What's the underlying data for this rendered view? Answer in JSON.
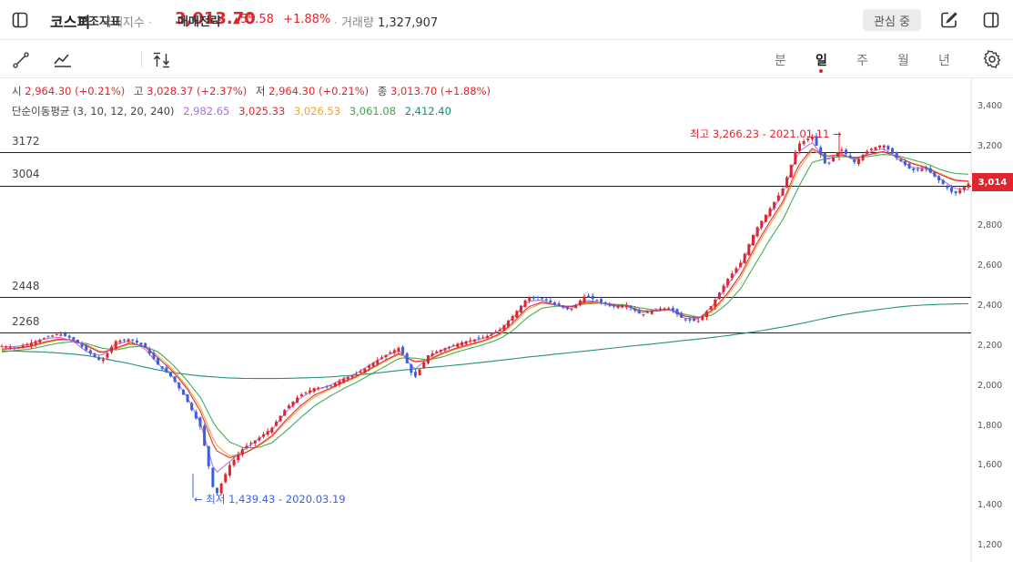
{
  "header": {
    "title": "코스피",
    "category": "국내지수",
    "price": "3,013.70",
    "change_arrow": "▲",
    "change": "55.58",
    "change_pct": "+1.88%",
    "volume_label": "거래량",
    "volume": "1,327,907",
    "favorite_label": "관심 중"
  },
  "toolbar": {
    "indicator_label": "보조지표",
    "strategy_label": "매매전략",
    "periods": [
      "분",
      "일",
      "주",
      "월",
      "년"
    ],
    "active_period": "일"
  },
  "ohlc": {
    "open_label": "시",
    "open": "2,964.30 (+0.21%)",
    "high_label": "고",
    "high": "3,028.37 (+2.37%)",
    "low_label": "저",
    "low": "2,964.30 (+0.21%)",
    "close_label": "종",
    "close": "3,013.70 (+1.88%)"
  },
  "ma": {
    "label": "단순이동평균 (3, 10, 12, 20, 240)",
    "values": [
      "2,982.65",
      "3,025.33",
      "3,026.53",
      "3,061.08",
      "2,412.40"
    ],
    "colors": [
      "#b06fd8",
      "#e0262c",
      "#f0a030",
      "#3aa84a",
      "#1a8a78"
    ]
  },
  "levels": [
    "3172",
    "3004",
    "2448",
    "2268"
  ],
  "current_price_tag": "3,014",
  "annotations": {
    "high": "최고 3,266.23 - 2021.01.11",
    "low": "최저 1,439.43 - 2020.03.19"
  },
  "colors": {
    "up": "#e0262c",
    "down": "#3c5fe0",
    "accent": "#e0262c"
  },
  "chart_data": {
    "type": "candlestick",
    "y_ticks": [
      "3,400",
      "3,200",
      "3,000",
      "2,800",
      "2,600",
      "2,400",
      "2,200",
      "2,000",
      "1,800",
      "1,600",
      "1,400",
      "1,200"
    ],
    "ylim": [
      1200,
      3400
    ],
    "horizontal_levels": [
      3172,
      3004,
      2448,
      2268
    ],
    "high": {
      "value": 3266.23,
      "date": "2021.01.11"
    },
    "low": {
      "value": 1439.43,
      "date": "2020.03.19"
    },
    "last_close": 3013.7,
    "close_path": [
      2200,
      2190,
      2215,
      2240,
      2262,
      2235,
      2175,
      2120,
      2225,
      2235,
      2200,
      2105,
      2040,
      1930,
      1790,
      1440,
      1600,
      1690,
      1735,
      1790,
      1890,
      1955,
      1990,
      1995,
      2035,
      2060,
      2110,
      2155,
      2195,
      2035,
      2155,
      2185,
      2210,
      2230,
      2245,
      2280,
      2355,
      2445,
      2440,
      2405,
      2380,
      2450,
      2425,
      2398,
      2405,
      2355,
      2388,
      2390,
      2330,
      2325,
      2410,
      2530,
      2620,
      2780,
      2885,
      2995,
      3210,
      3250,
      3100,
      3190,
      3120,
      3185,
      3210,
      3140,
      3080,
      3090,
      3025,
      2960,
      3013.7
    ],
    "ma_series": [
      {
        "name": "3",
        "last": 2982.65,
        "values": [
          2195,
          2198,
          2210,
          2235,
          2245,
          2225,
          2170,
          2150,
          2210,
          2225,
          2190,
          2110,
          2050,
          1950,
          1810,
          1560,
          1620,
          1680,
          1730,
          1780,
          1870,
          1940,
          1980,
          2000,
          2035,
          2065,
          2110,
          2150,
          2180,
          2080,
          2140,
          2180,
          2205,
          2225,
          2240,
          2275,
          2345,
          2425,
          2430,
          2405,
          2385,
          2430,
          2420,
          2400,
          2400,
          2365,
          2380,
          2385,
          2340,
          2335,
          2400,
          2500,
          2600,
          2750,
          2860,
          2970,
          3170,
          3220,
          3130,
          3170,
          3130,
          3170,
          3190,
          3140,
          3095,
          3090,
          3040,
          2990,
          2982.65
        ]
      },
      {
        "name": "10",
        "last": 3025.33,
        "values": [
          2185,
          2190,
          2200,
          2220,
          2235,
          2230,
          2200,
          2165,
          2190,
          2215,
          2200,
          2140,
          2075,
          1990,
          1870,
          1680,
          1640,
          1660,
          1700,
          1750,
          1830,
          1900,
          1955,
          1985,
          2020,
          2050,
          2090,
          2130,
          2165,
          2120,
          2130,
          2165,
          2190,
          2210,
          2230,
          2260,
          2320,
          2395,
          2420,
          2405,
          2395,
          2420,
          2420,
          2405,
          2400,
          2375,
          2375,
          2385,
          2350,
          2340,
          2380,
          2460,
          2560,
          2700,
          2820,
          2930,
          3100,
          3190,
          3150,
          3160,
          3140,
          3160,
          3175,
          3150,
          3115,
          3095,
          3060,
          3030,
          3025.33
        ]
      },
      {
        "name": "12",
        "last": 3026.53,
        "values": [
          2180,
          2188,
          2195,
          2215,
          2230,
          2230,
          2205,
          2170,
          2185,
          2210,
          2200,
          2150,
          2085,
          2000,
          1890,
          1710,
          1650,
          1660,
          1695,
          1745,
          1820,
          1890,
          1945,
          1980,
          2015,
          2045,
          2085,
          2125,
          2160,
          2125,
          2125,
          2160,
          2185,
          2205,
          2225,
          2255,
          2310,
          2385,
          2415,
          2405,
          2395,
          2415,
          2418,
          2405,
          2400,
          2378,
          2375,
          2383,
          2352,
          2340,
          2370,
          2450,
          2545,
          2685,
          2805,
          2915,
          3080,
          3180,
          3150,
          3158,
          3140,
          3158,
          3172,
          3150,
          3118,
          3098,
          3065,
          3035,
          3026.53
        ]
      },
      {
        "name": "20",
        "last": 3061.08,
        "values": [
          2170,
          2178,
          2185,
          2200,
          2215,
          2222,
          2212,
          2190,
          2180,
          2195,
          2200,
          2170,
          2110,
          2030,
          1940,
          1800,
          1720,
          1690,
          1690,
          1715,
          1775,
          1840,
          1900,
          1945,
          1985,
          2020,
          2060,
          2100,
          2140,
          2140,
          2130,
          2145,
          2170,
          2190,
          2210,
          2235,
          2280,
          2345,
          2390,
          2400,
          2400,
          2410,
          2415,
          2410,
          2405,
          2390,
          2380,
          2380,
          2360,
          2345,
          2355,
          2410,
          2490,
          2610,
          2730,
          2840,
          2990,
          3120,
          3140,
          3150,
          3145,
          3150,
          3160,
          3155,
          3135,
          3115,
          3085,
          3065,
          3061.08
        ]
      },
      {
        "name": "240",
        "last": 2412.4,
        "values": [
          2175,
          2175,
          2172,
          2170,
          2165,
          2160,
          2152,
          2140,
          2125,
          2112,
          2095,
          2080,
          2068,
          2058,
          2050,
          2045,
          2040,
          2038,
          2037,
          2037,
          2038,
          2040,
          2042,
          2045,
          2050,
          2055,
          2062,
          2070,
          2078,
          2085,
          2092,
          2098,
          2105,
          2112,
          2120,
          2128,
          2136,
          2145,
          2152,
          2160,
          2167,
          2174,
          2182,
          2190,
          2198,
          2205,
          2212,
          2220,
          2228,
          2235,
          2243,
          2252,
          2262,
          2272,
          2284,
          2296,
          2310,
          2325,
          2340,
          2354,
          2366,
          2376,
          2386,
          2395,
          2402,
          2406,
          2409,
          2411,
          2412.4
        ]
      }
    ]
  }
}
